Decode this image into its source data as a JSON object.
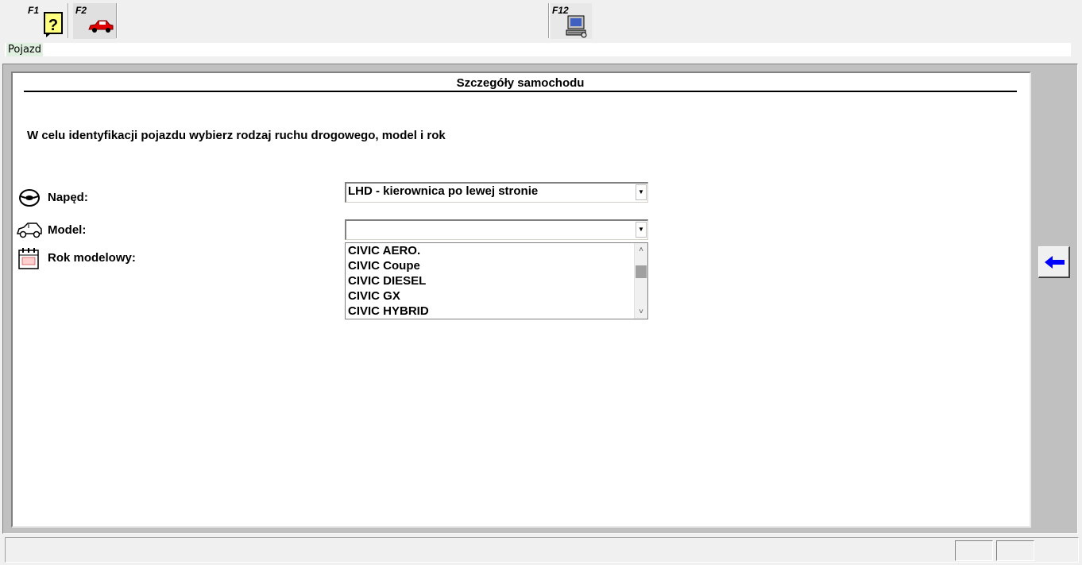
{
  "toolbar": {
    "help_key": "F1",
    "vehicle_key": "F2",
    "connect_key": "F12"
  },
  "breadcrumb": {
    "label": "Pojazd"
  },
  "panel": {
    "title": "Szczegóły samochodu",
    "instruction": "W celu identyfikacji pojazdu wybierz rodzaj ruchu drogowego, model i rok"
  },
  "fields": {
    "drive": {
      "label": "Napęd:",
      "value": "LHD - kierownica po lewej stronie"
    },
    "model": {
      "label": "Model:",
      "value": ""
    },
    "year": {
      "label": "Rok modelowy:"
    }
  },
  "model_options": [
    "CIVIC AERO.",
    "CIVIC Coupe",
    "CIVIC DIESEL",
    "CIVIC GX",
    "CIVIC HYBRID"
  ],
  "icons": {
    "help": "help-icon",
    "vehicle": "car-icon",
    "connect": "computer-connect-icon",
    "steering": "steering-wheel-icon",
    "model": "car-outline-icon",
    "calendar": "calendar-icon",
    "back": "back-arrow-icon"
  },
  "colors": {
    "breadcrumb_bg": "#e0f0e0",
    "back_arrow": "#0000ff",
    "help_icon": "#ffff80",
    "car_red": "#e00000"
  }
}
